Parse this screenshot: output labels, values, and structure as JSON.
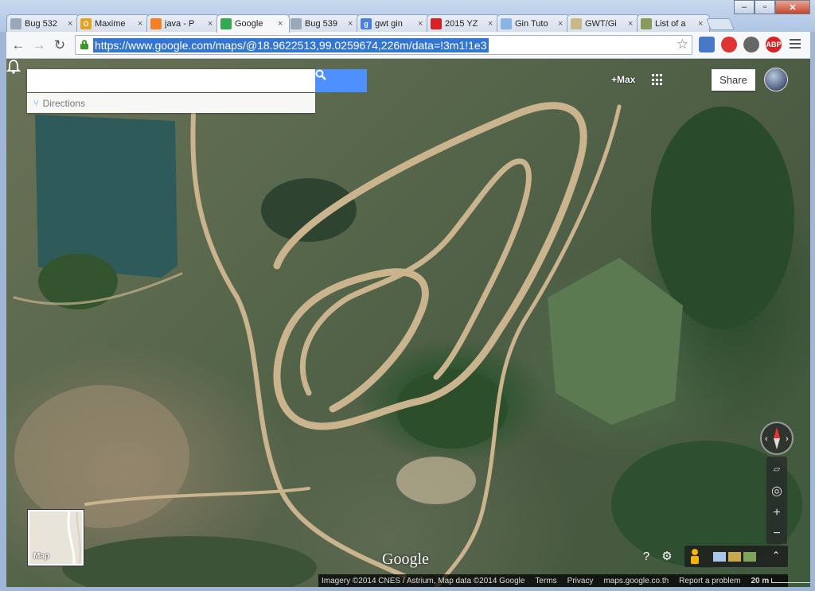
{
  "browser": {
    "tabs": [
      {
        "label": "Bug 532",
        "favicon": "bug-icon",
        "color": "#9aa7b8"
      },
      {
        "label": "Maxime",
        "favicon": "O",
        "color": "#e6a21c"
      },
      {
        "label": "java - P",
        "favicon": "stack-icon",
        "color": "#f48024"
      },
      {
        "label": "Google",
        "favicon": "maps-icon",
        "color": "#34a853",
        "active": true
      },
      {
        "label": "Bug 539",
        "favicon": "bug-icon",
        "color": "#9aa7b8"
      },
      {
        "label": "gwt gin",
        "favicon": "g",
        "color": "#4a7fe0"
      },
      {
        "label": "2015 YZ",
        "favicon": "youtube-icon",
        "color": "#d62222"
      },
      {
        "label": "Gin Tuto",
        "favicon": "cloud-icon",
        "color": "#8ab4e8"
      },
      {
        "label": "GWT/Gi",
        "favicon": "page-icon",
        "color": "#c8b88a"
      },
      {
        "label": "List of a",
        "favicon": "page-icon",
        "color": "#8a9a5a"
      }
    ],
    "close_glyph": "×",
    "url": "https://www.google.com/maps/@18.9622513,99.0259674,226m/data=!3m1!1e3",
    "extensions": [
      {
        "name": "screenshot-extension-icon",
        "text": "",
        "color": "#4a78c8"
      },
      {
        "name": "stop-extension-icon",
        "text": "",
        "color": "#d33"
      },
      {
        "name": "eyedropper-extension-icon",
        "text": "",
        "color": "#666"
      },
      {
        "name": "adblock-extension-icon",
        "text": "ABP",
        "color": "#d62222"
      }
    ]
  },
  "maps": {
    "search_placeholder": "",
    "directions_label": "Directions",
    "plus_name": "+Max",
    "share_label": "Share",
    "minimap_label": "Map",
    "google_logo": "Google",
    "footer": {
      "imagery": "Imagery ©2014 CNES / Astrium, Map data ©2014 Google",
      "terms": "Terms",
      "privacy": "Privacy",
      "domain": "maps.google.co.th",
      "report": "Report a problem",
      "scale": "20 m"
    },
    "colors": {
      "search_button": "#4d90fe",
      "track": "#c9b48e",
      "pond": "#2e5a5a"
    }
  }
}
